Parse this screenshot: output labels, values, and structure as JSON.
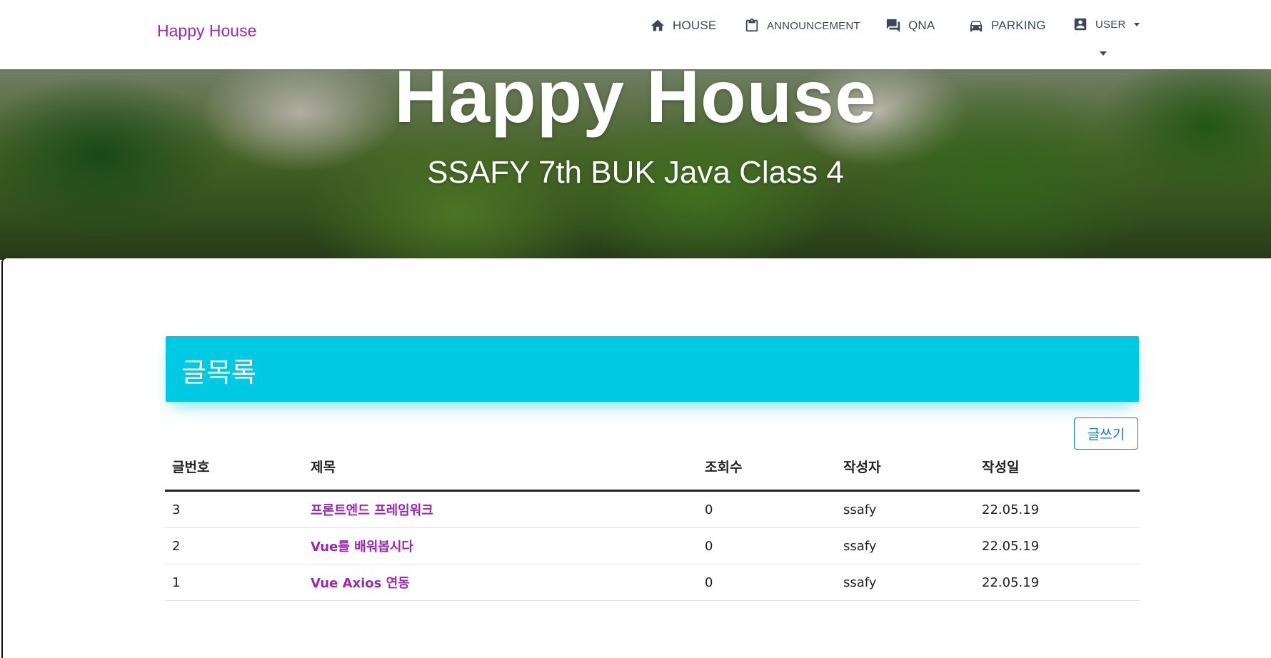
{
  "navbar": {
    "brand": "Happy House",
    "items": [
      {
        "label": "HOUSE",
        "icon": "home-icon"
      },
      {
        "label": "ANNOUNCEMENT",
        "icon": "clipboard-icon"
      },
      {
        "label": "QNA",
        "icon": "forum-icon"
      },
      {
        "label": "PARKING",
        "icon": "car-icon"
      },
      {
        "label": "USER",
        "icon": "account-box-icon"
      }
    ]
  },
  "hero": {
    "title": "Happy House",
    "subtitle": "SSAFY 7th BUK Java Class 4"
  },
  "board": {
    "header": "글목록",
    "write_label": "글쓰기",
    "columns": [
      "글번호",
      "제목",
      "조회수",
      "작성자",
      "작성일"
    ],
    "rows": [
      {
        "no": "3",
        "title": "프론트엔드 프레임워크",
        "hit": "0",
        "user": "ssafy",
        "date": "22.05.19"
      },
      {
        "no": "2",
        "title": "Vue를 배워봅시다",
        "hit": "0",
        "user": "ssafy",
        "date": "22.05.19"
      },
      {
        "no": "1",
        "title": "Vue Axios 연동",
        "hit": "0",
        "user": "ssafy",
        "date": "22.05.19"
      }
    ]
  },
  "colors": {
    "brand": "#9c27b0",
    "header_bg": "#00c9e3",
    "button_outline": "#1976d2"
  }
}
